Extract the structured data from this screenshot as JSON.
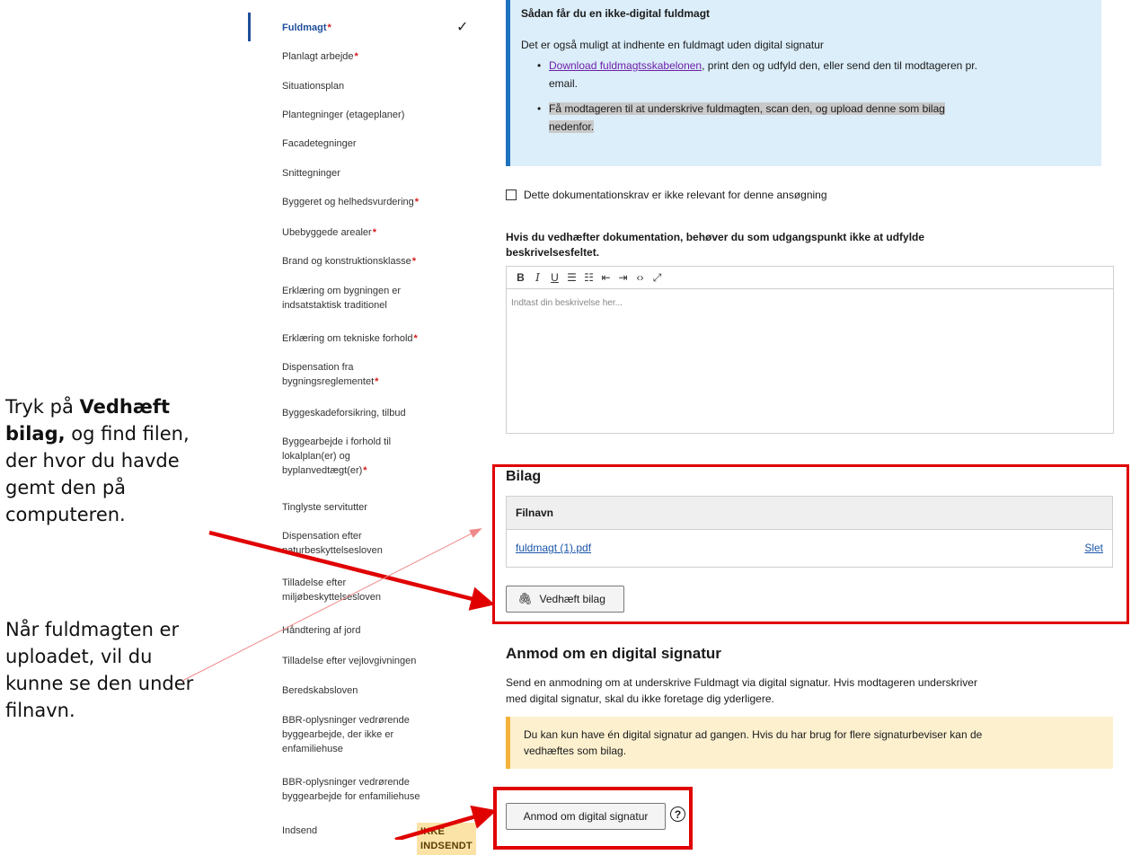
{
  "annotations": {
    "attach_pre": "Tryk på ",
    "attach_bold": "Vedhæft bilag,",
    "attach_post": " og find filen, der hvor du havde gemt den på computeren.",
    "uploaded": "Når fuldmagten er uploadet, vil du kunne se den under filnavn."
  },
  "sidebar": {
    "items": [
      {
        "label": "Fuldmagt",
        "required": "*"
      },
      {
        "label": "Planlagt arbejde",
        "required": "*"
      },
      {
        "label": "Situationsplan",
        "required": ""
      },
      {
        "label": "Plantegninger (etageplaner)",
        "required": ""
      },
      {
        "label": "Facadetegninger",
        "required": ""
      },
      {
        "label": "Snittegninger",
        "required": ""
      },
      {
        "label": "Byggeret og helhedsvurdering",
        "required": "*"
      },
      {
        "label": "Ubebyggede arealer",
        "required": "*"
      },
      {
        "label": "Brand og konstruktionsklasse",
        "required": "*"
      },
      {
        "label": "Erklæring om bygningen er indsatstaktisk traditionel",
        "required": ""
      },
      {
        "label": "Erklæring om tekniske forhold",
        "required": "*"
      },
      {
        "label": "Dispensation fra bygningsreglementet",
        "required": "*"
      },
      {
        "label": "Byggeskadeforsikring, tilbud",
        "required": ""
      },
      {
        "label": "Byggearbejde i forhold til lokalplan(er) og byplanvedtægt(er)",
        "required": "*"
      },
      {
        "label": "Tinglyste servitutter",
        "required": ""
      },
      {
        "label": "Dispensation efter naturbeskyttelsesloven",
        "required": ""
      },
      {
        "label": "Tilladelse efter miljøbeskyttelsesloven",
        "required": ""
      },
      {
        "label": "Håndtering af jord",
        "required": ""
      },
      {
        "label": "Tilladelse efter vejlovgivningen",
        "required": ""
      },
      {
        "label": "Beredskabsloven",
        "required": ""
      },
      {
        "label": "BBR-oplysninger vedrørende byggearbejde, der ikke er enfamiliehuse",
        "required": ""
      },
      {
        "label": "BBR-oplysninger vedrørende byggearbejde for enfamiliehuse",
        "required": ""
      },
      {
        "label": "Indsend",
        "required": ""
      }
    ],
    "submit_badge": "IKKE INDSENDT"
  },
  "info": {
    "title": "Sådan får du en ikke-digital fuldmagt",
    "intro": "Det er også muligt at indhente en fuldmagt uden digital signatur",
    "bullet1_link": "Download fuldmagtsskabelonen",
    "bullet1_rest": ", print den og udfyld den, eller send den til modtageren pr. email.",
    "bullet2": "Få modtageren til at underskrive fuldmagten, scan den, og upload denne som bilag nedenfor."
  },
  "not_relevant_label": "Dette dokumentationskrav er ikke relevant for denne ansøgning",
  "description": {
    "label": "Hvis du vedhæfter dokumentation, behøver du som udgangspunkt ikke at udfylde beskrivelsesfeltet.",
    "placeholder": "Indtast din beskrivelse her...",
    "toolbar": [
      "B",
      "I",
      "U",
      "☰",
      "☷",
      "⇤",
      "⇥",
      "‹›",
      "⤢"
    ]
  },
  "attachments": {
    "title": "Bilag",
    "column": "Filnavn",
    "files": [
      {
        "name": "fuldmagt (1).pdf",
        "delete": "Slet"
      }
    ],
    "attach_button": "Vedhæft bilag"
  },
  "signature": {
    "title": "Anmod om en digital signatur",
    "text": "Send en anmodning om at underskrive Fuldmagt via digital signatur. Hvis modtageren underskriver med digital signatur, skal du ikke foretage dig yderligere.",
    "warning": "Du kan kun have én digital signatur ad gangen. Hvis du har brug for flere signaturbeviser kan de vedhæftes som bilag.",
    "button": "Anmod om digital signatur",
    "help": "?"
  },
  "colors": {
    "highlight": "#e00000",
    "nav_active": "#1f4f9a",
    "required": "#d41c1c"
  }
}
